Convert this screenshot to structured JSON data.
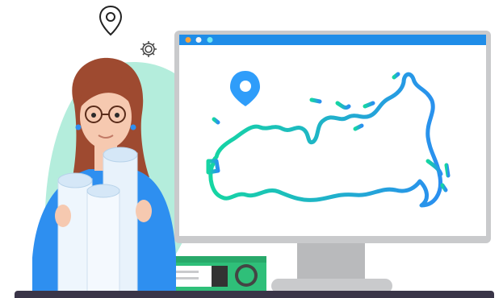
{
  "colors": {
    "monitor_frame": "#c9cacc",
    "title_bar": "#1f8de8",
    "window_dot_1": "#f6a23b",
    "window_dot_2": "#f5f5f5",
    "window_dot_3": "#6ee7f2",
    "map_gradient_start": "#15d6a2",
    "map_gradient_end": "#2a8ff0",
    "map_pin": "#2f9dfa",
    "blob_mint": "#b4eddc",
    "hair": "#9e4a30",
    "skin": "#f6c9b0",
    "sweater": "#2e8ff0",
    "folder_green": "#2fbf79",
    "desk": "#3a3548"
  },
  "icons": {
    "top_pin": "location-pin-outline-icon",
    "gear": "gear-icon",
    "map_pin": "location-pin-icon"
  }
}
